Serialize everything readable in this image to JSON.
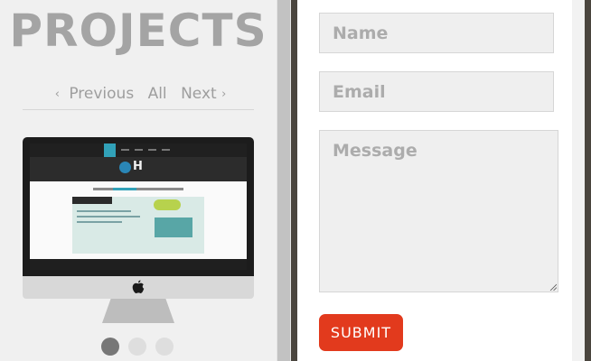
{
  "projects": {
    "title": "PROJECTS",
    "nav": {
      "previous": "Previous",
      "all": "All",
      "next": "Next",
      "prev_arrow": "‹",
      "next_arrow": "›"
    },
    "carousel": {
      "pages": 3,
      "active_page": 1
    }
  },
  "contact": {
    "name_placeholder": "Name",
    "email_placeholder": "Email",
    "message_placeholder": "Message",
    "submit_label": "SUBMIT"
  },
  "colors": {
    "title": "#a4a4a4",
    "submit_background": "#e23a1d",
    "field_background": "#efefef",
    "dot_active": "#777777",
    "dot_inactive": "#dedede"
  },
  "icons": [
    "apple-icon",
    "resize-handle-icon"
  ]
}
